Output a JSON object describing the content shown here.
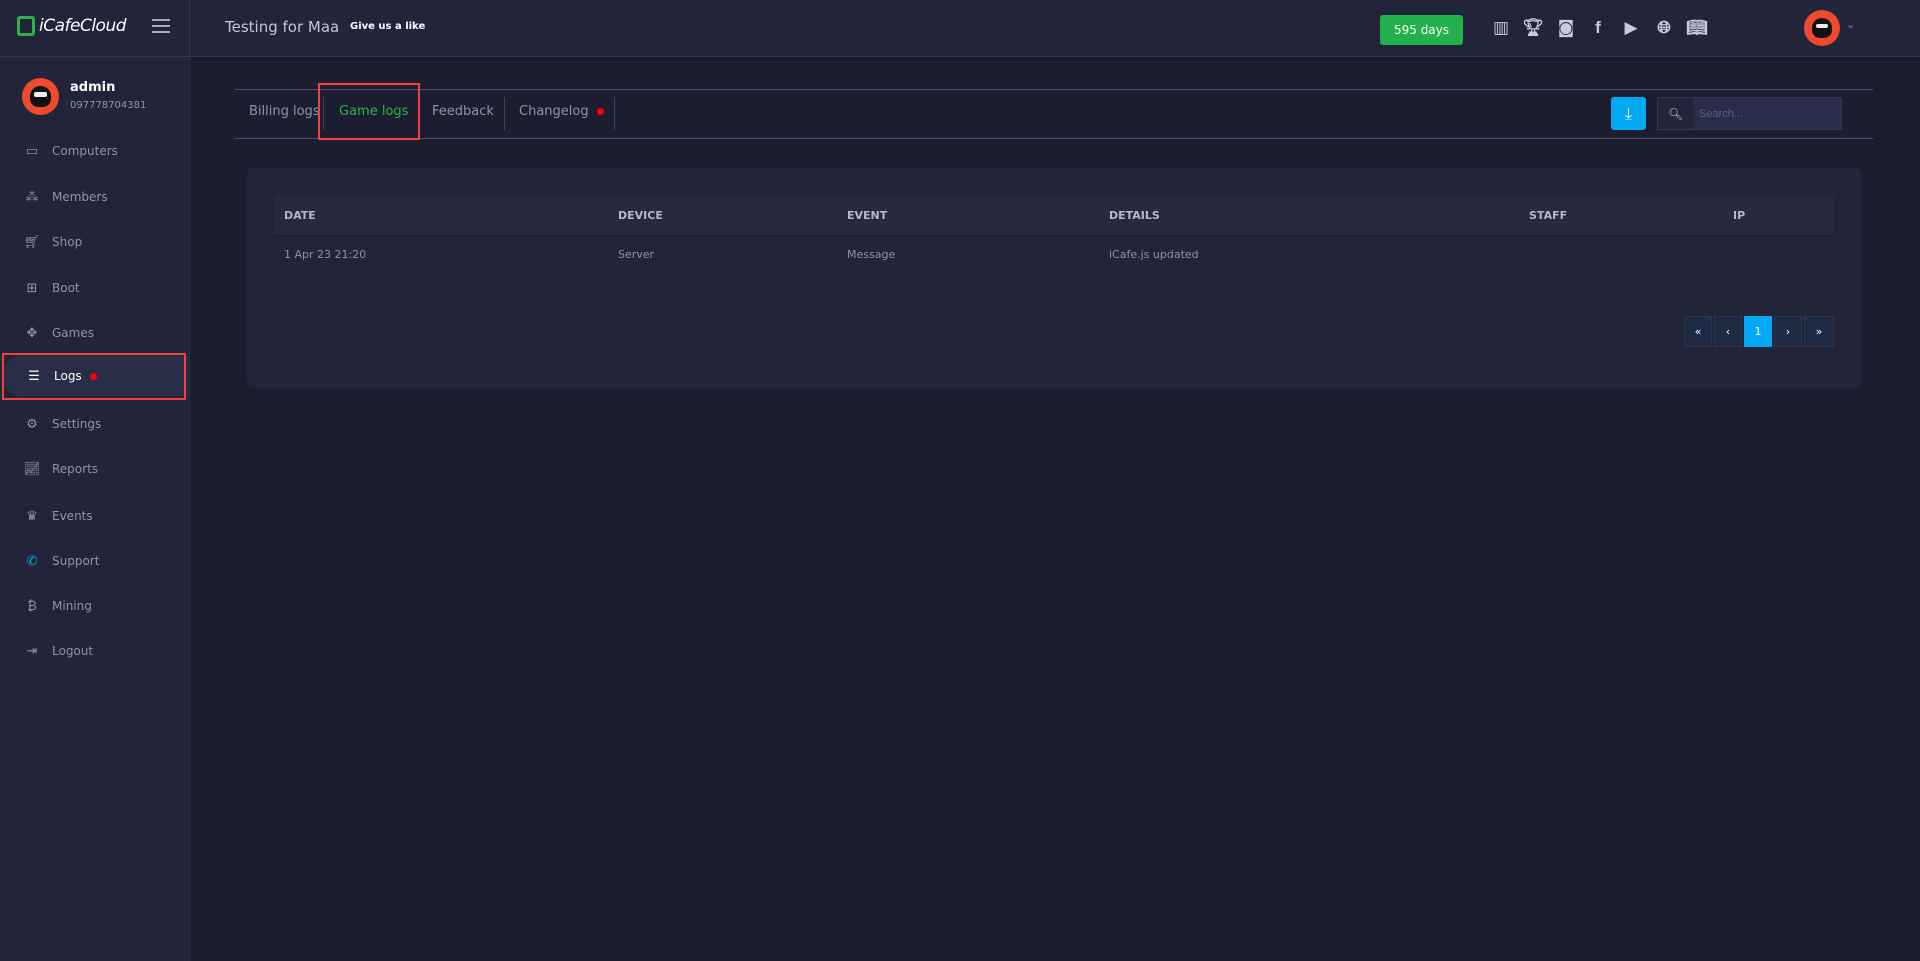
{
  "brand": "iCafeCloud",
  "header": {
    "title": "Testing for Maa",
    "like": "Give us a like",
    "days": "595 days",
    "icons": [
      "leaderboard-icon",
      "trophy-icon",
      "discord-icon",
      "facebook-icon",
      "youtube-icon",
      "globe-icon",
      "book-icon"
    ]
  },
  "user": {
    "name": "admin",
    "phone": "097778704381"
  },
  "sidebar": {
    "items": [
      {
        "label": "Computers",
        "icon": "monitor-icon"
      },
      {
        "label": "Members",
        "icon": "users-icon"
      },
      {
        "label": "Shop",
        "icon": "cart-icon"
      },
      {
        "label": "Boot",
        "icon": "windows-icon"
      },
      {
        "label": "Games",
        "icon": "gamepad-icon"
      },
      {
        "label": "Logs",
        "icon": "list-icon"
      },
      {
        "label": "Settings",
        "icon": "gear-icon"
      },
      {
        "label": "Reports",
        "icon": "chart-icon"
      },
      {
        "label": "Events",
        "icon": "crown-icon"
      },
      {
        "label": "Support",
        "icon": "phone-icon"
      },
      {
        "label": "Mining",
        "icon": "bitcoin-icon"
      },
      {
        "label": "Logout",
        "icon": "logout-icon"
      }
    ]
  },
  "tabs": [
    {
      "label": "Billing logs"
    },
    {
      "label": "Game logs"
    },
    {
      "label": "Feedback"
    },
    {
      "label": "Changelog"
    }
  ],
  "search": {
    "placeholder": "Search..."
  },
  "table": {
    "headers": [
      "DATE",
      "DEVICE",
      "EVENT",
      "DETAILS",
      "STAFF",
      "IP"
    ],
    "rows": [
      [
        "1 Apr 23 21:20",
        "Server",
        "Message",
        "iCafe.js updated",
        "",
        ""
      ]
    ]
  },
  "pagination": {
    "first": "«",
    "prev": "‹",
    "current": "1",
    "next": "›",
    "last": "»"
  },
  "colors": {
    "accent": "#02a9f4",
    "success": "#22b14c",
    "active_tab": "#2fb14c",
    "alert": "#ff0000"
  }
}
